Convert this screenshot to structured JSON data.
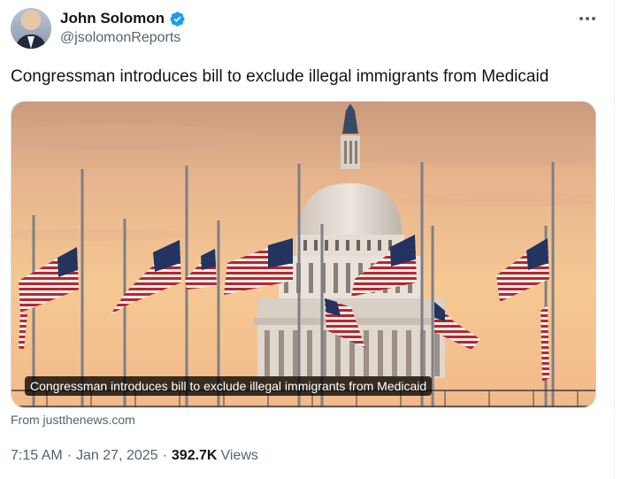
{
  "author": {
    "display_name": "John Solomon",
    "handle": "@jsolomonReports",
    "verified": true
  },
  "tweet": {
    "text": "Congressman introduces bill to exclude illegal immigrants from Medicaid"
  },
  "card": {
    "image_subject": "us-capitol-dome-with-half-mast-flags-at-sunset",
    "title": "Congressman introduces bill to exclude illegal immigrants from Medicaid",
    "source": "From justthenews.com"
  },
  "meta": {
    "time": "7:15 AM",
    "separator": "·",
    "date": "Jan 27, 2025",
    "views_count": "392.7K",
    "views_label": "Views"
  },
  "colors": {
    "verified_blue": "#1d9bf0",
    "secondary_text": "#536471",
    "primary_text": "#0f1419",
    "sky_top": "#cf9f7f",
    "sky_bottom": "#f3c28e"
  }
}
